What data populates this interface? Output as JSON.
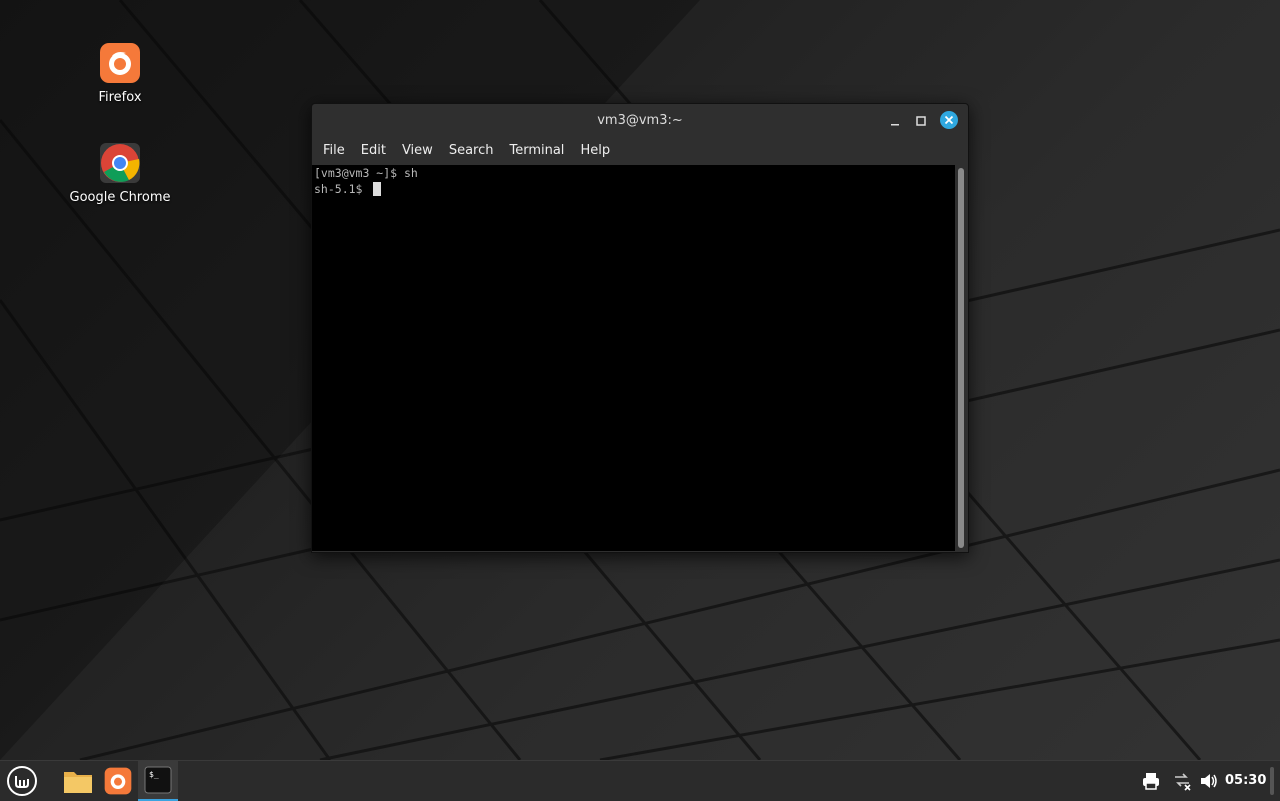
{
  "desktop": {
    "icons": [
      {
        "label": "Firefox"
      },
      {
        "label": "Google Chrome"
      }
    ]
  },
  "window": {
    "title": "vm3@vm3:~",
    "menu": [
      "File",
      "Edit",
      "View",
      "Search",
      "Terminal",
      "Help"
    ],
    "terminal_lines": [
      "[vm3@vm3 ~]$ sh",
      "sh-5.1$ "
    ]
  },
  "taskbar": {
    "clock": "05:30"
  },
  "colors": {
    "accent": "#2fa8e0",
    "firefox": "#f5793a",
    "folder": "#e8b04a"
  }
}
